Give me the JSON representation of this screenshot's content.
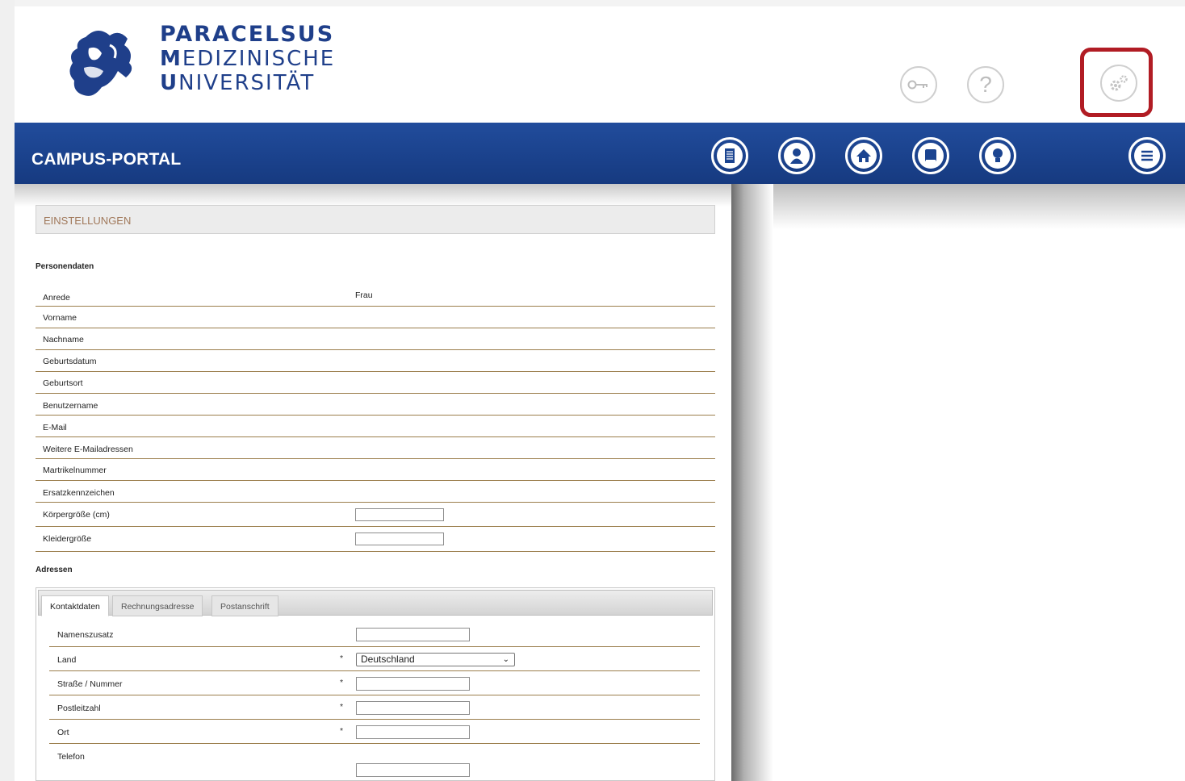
{
  "header": {
    "logo_line1": "PARACELSUS",
    "logo_line2_first": "M",
    "logo_line2_rest": "EDIZINISCHE",
    "logo_line3_first": "U",
    "logo_line3_rest": "NIVERSITÄT",
    "help_glyph": "?",
    "key_icon": "key-icon",
    "settings_icon": "settings-gear-icon",
    "highlight_color": "#b11c24"
  },
  "navbar": {
    "title": "CAMPUS-PORTAL",
    "icons": [
      "document-icon",
      "user-icon",
      "home-icon",
      "book-icon",
      "lightbulb-icon",
      "menu-icon"
    ],
    "bar_color": "#1b4490"
  },
  "section": {
    "title": "EINSTELLUNGEN"
  },
  "personal": {
    "title": "Personendaten",
    "rows": [
      {
        "label": "Anrede",
        "value": "Frau"
      },
      {
        "label": "Vorname",
        "value": ""
      },
      {
        "label": "Nachname",
        "value": ""
      },
      {
        "label": "Geburtsdatum",
        "value": ""
      },
      {
        "label": "Geburtsort",
        "value": ""
      },
      {
        "label": "Benutzername",
        "value": ""
      },
      {
        "label": "E-Mail",
        "value": ""
      },
      {
        "label": "Weitere E-Mailadressen",
        "value": ""
      },
      {
        "label": "Martrikelnummer",
        "value": ""
      },
      {
        "label": "Ersatzkennzeichen",
        "value": ""
      }
    ],
    "height_label": "Körpergröße (cm)",
    "height_value": "",
    "clothing_label": "Kleidergröße",
    "clothing_value": ""
  },
  "addresses": {
    "title": "Adressen",
    "tabs": [
      "Kontaktdaten",
      "Rechnungsadresse",
      "Postanschrift"
    ],
    "fields": [
      {
        "label": "Namenszusatz",
        "required": "",
        "value": ""
      },
      {
        "label": "Land",
        "required": "*",
        "value": "Deutschland"
      },
      {
        "label": "Straße / Nummer",
        "required": "*",
        "value": ""
      },
      {
        "label": "Postleitzahl",
        "required": "*",
        "value": ""
      },
      {
        "label": "Ort",
        "required": "*",
        "value": ""
      },
      {
        "label": "Telefon",
        "required": "",
        "value": ""
      }
    ]
  }
}
